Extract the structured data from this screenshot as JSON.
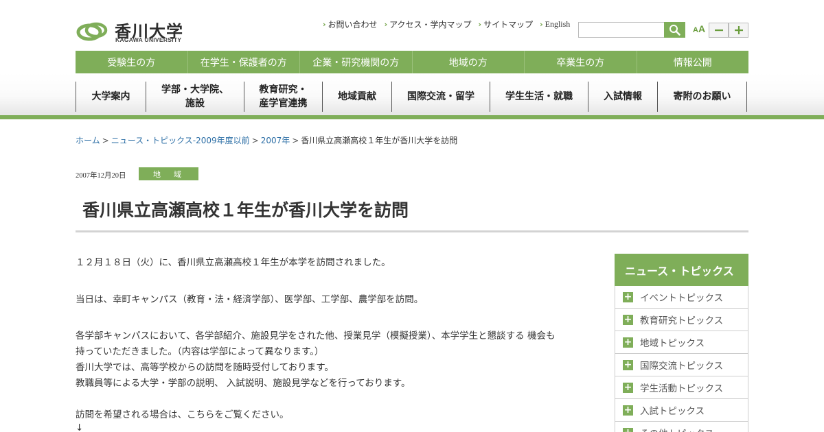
{
  "header": {
    "logo_jp": "香川大学",
    "logo_en": "KAGAWA UNIVERSITY",
    "util_links": [
      "お問い合わせ",
      "アクセス・学内マップ",
      "サイトマップ",
      "English"
    ],
    "search_placeholder": "",
    "font_size_label_small": "A",
    "font_size_label_large": "A"
  },
  "audience_nav": [
    "受験生の方",
    "在学生・保護者の方",
    "企業・研究機関の方",
    "地域の方",
    "卒業生の方",
    "情報公開"
  ],
  "main_nav": [
    "大学案内",
    "学部・大学院、施設",
    "教育研究・産学官連携",
    "地域貢献",
    "国際交流・留学",
    "学生生活・就職",
    "入試情報",
    "寄附のお願い"
  ],
  "breadcrumb": {
    "links": [
      "ホーム",
      "ニュース・トピックス-2009年度以前",
      "2007年"
    ],
    "separator": ">",
    "current": "香川県立高瀬高校１年生が香川大学を訪問"
  },
  "article": {
    "date": "2007年12月20日",
    "category": "地　域",
    "title": "香川県立高瀬高校１年生が香川大学を訪問",
    "paragraphs": [
      "１２月１８日（火）に、香川県立高瀬高校１年生が本学を訪問されました。",
      "当日は、幸町キャンパス（教育・法・経済学部）、医学部、工学部、農学部を訪問。",
      "各学部キャンパスにおいて、各学部紹介、施設見学をされた他、授業見学（模擬授業）、本学学生と懇談する 機会も",
      "持っていただきました。（内容は学部によって異なります。）",
      "香川大学では、高等学校からの訪問を随時受付しております。",
      "教職員等による大学・学部の説明、 入試説明、施設見学などを行っております。",
      "訪問を希望される場合は、こちらをご覧ください。",
      "↓"
    ]
  },
  "sidebar": {
    "heading": "ニュース・トピックス",
    "items": [
      "イベントトピックス",
      "教育研究トピックス",
      "地域トピックス",
      "国際交流トピックス",
      "学生活動トピックス",
      "入試トピックス",
      "その他トピックス"
    ]
  },
  "colors": {
    "brand_green": "#7fae59",
    "link_blue": "#2d6fa6",
    "text": "#333333"
  }
}
